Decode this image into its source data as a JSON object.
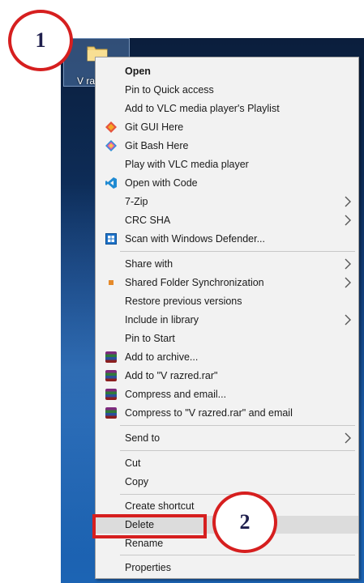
{
  "desktop": {
    "folder_label": "V ra"
  },
  "callouts": {
    "step1": "1",
    "step2": "2"
  },
  "menu": {
    "items": [
      {
        "label": "Open",
        "bold": true,
        "icon": "",
        "submenu": false
      },
      {
        "label": "Pin to Quick access",
        "icon": "",
        "submenu": false
      },
      {
        "label": "Add to VLC media player's Playlist",
        "icon": "",
        "submenu": false
      },
      {
        "label": "Git GUI Here",
        "icon": "git-gui-icon",
        "submenu": false
      },
      {
        "label": "Git Bash Here",
        "icon": "git-bash-icon",
        "submenu": false
      },
      {
        "label": "Play with VLC media player",
        "icon": "",
        "submenu": false
      },
      {
        "label": "Open with Code",
        "icon": "vscode-icon",
        "submenu": false
      },
      {
        "label": "7-Zip",
        "icon": "",
        "submenu": true
      },
      {
        "label": "CRC SHA",
        "icon": "",
        "submenu": true
      },
      {
        "label": "Scan with Windows Defender...",
        "icon": "windows-defender-icon",
        "submenu": false
      },
      {
        "label": "Share with",
        "icon": "",
        "submenu": true
      },
      {
        "label": "Shared Folder Synchronization",
        "icon": "sync-icon",
        "submenu": true
      },
      {
        "label": "Restore previous versions",
        "icon": "",
        "submenu": false
      },
      {
        "label": "Include in library",
        "icon": "",
        "submenu": true
      },
      {
        "label": "Pin to Start",
        "icon": "",
        "submenu": false
      },
      {
        "label": "Add to archive...",
        "icon": "winrar-icon",
        "submenu": false
      },
      {
        "label": "Add to \"V razred.rar\"",
        "icon": "winrar-icon",
        "submenu": false
      },
      {
        "label": "Compress and email...",
        "icon": "winrar-icon",
        "submenu": false
      },
      {
        "label": "Compress to \"V razred.rar\" and email",
        "icon": "winrar-icon",
        "submenu": false
      },
      {
        "label": "Send to",
        "icon": "",
        "submenu": true
      },
      {
        "label": "Cut",
        "icon": "",
        "submenu": false
      },
      {
        "label": "Copy",
        "icon": "",
        "submenu": false
      },
      {
        "label": "Create shortcut",
        "icon": "",
        "submenu": false
      },
      {
        "label": "Delete",
        "icon": "",
        "submenu": false,
        "highlighted": true
      },
      {
        "label": "Rename",
        "icon": "",
        "submenu": false
      },
      {
        "label": "Properties",
        "icon": "",
        "submenu": false
      }
    ]
  },
  "colors": {
    "callout_border": "#d61f1f",
    "menu_bg": "#f2f2f2",
    "highlight": "#dcdcdc"
  }
}
